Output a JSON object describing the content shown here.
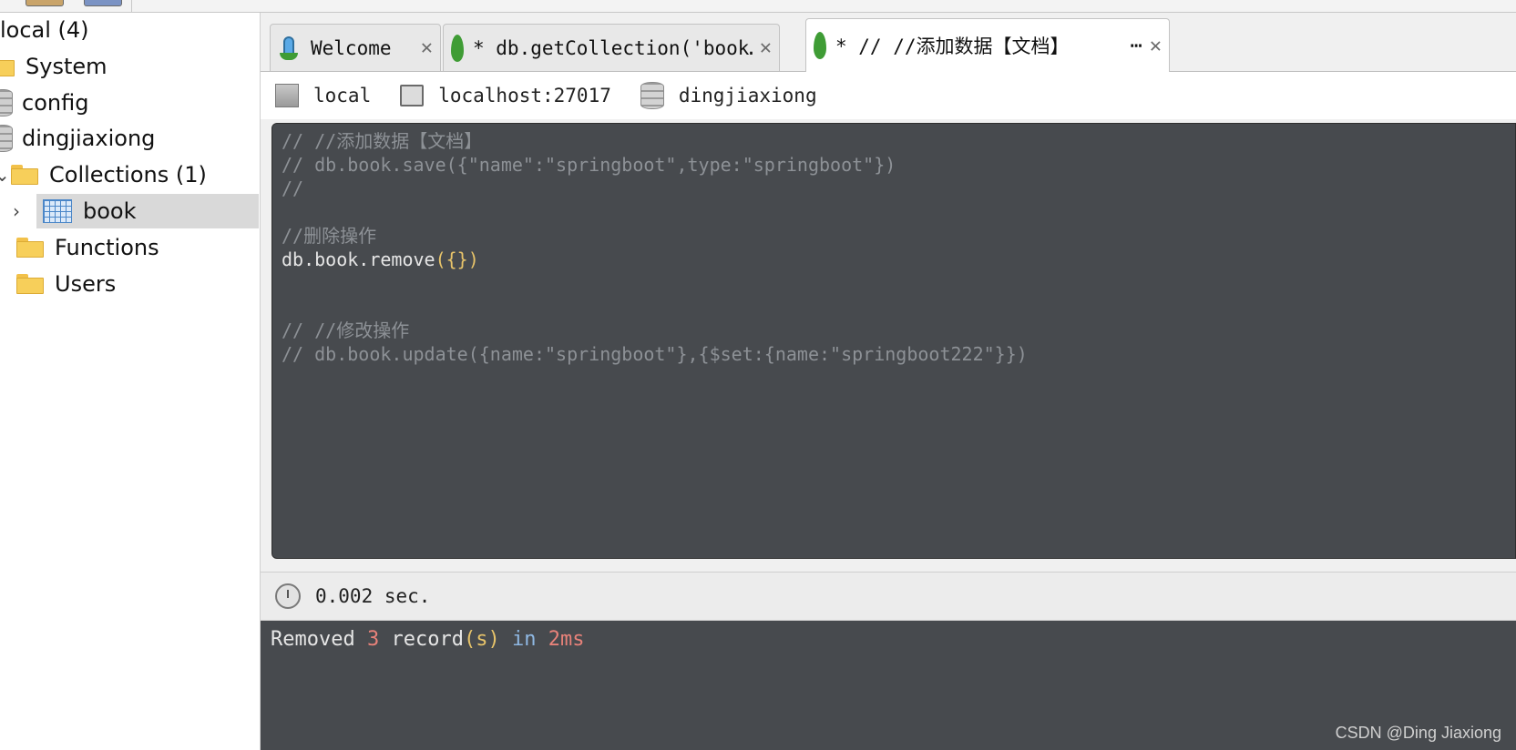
{
  "sidebar": {
    "root": "local (4)",
    "items": [
      {
        "label": "System"
      },
      {
        "label": "config"
      },
      {
        "label": "dingjiaxiong"
      },
      {
        "label": "Collections (1)"
      },
      {
        "label": "book"
      },
      {
        "label": "Functions"
      },
      {
        "label": "Users"
      }
    ]
  },
  "tabs": [
    {
      "label": "Welcome"
    },
    {
      "label": "* db.getCollection('book…"
    },
    {
      "label": "* // //添加数据【文档】",
      "more": "⋯"
    }
  ],
  "connection": {
    "name": "local",
    "host": "localhost:27017",
    "database": "dingjiaxiong"
  },
  "editor": {
    "lines": [
      "// //添加数据【文档】",
      "// db.book.save({\"name\":\"springboot\",type:\"springboot\"})",
      "//",
      "//删除操作",
      "db.book.remove",
      "// //修改操作",
      "// db.book.update({name:\"springboot\"},{$set:{name:\"springboot222\"}})"
    ],
    "remove_args": "({})"
  },
  "status": {
    "time": "0.002 sec."
  },
  "output": {
    "prefix": "Removed",
    "count": "3",
    "word": "record",
    "suffix": "(s)",
    "in_word": "in",
    "duration": "2ms"
  },
  "watermark": "CSDN @Ding Jiaxiong"
}
